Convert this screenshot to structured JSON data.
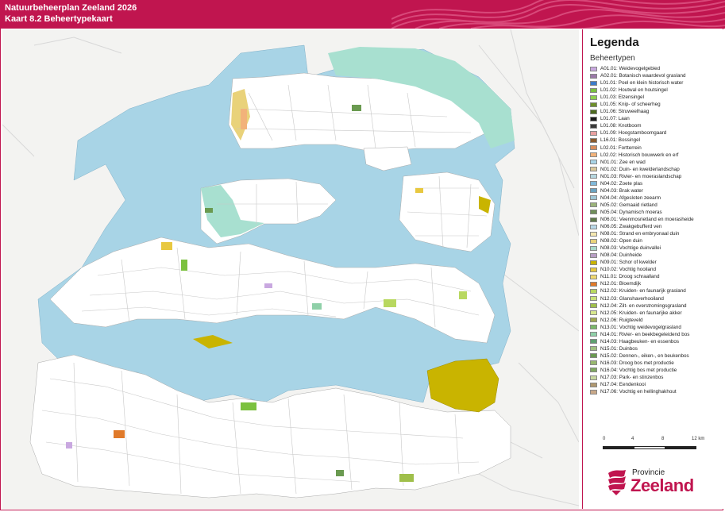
{
  "header": {
    "title": "Natuurbeheerplan Zeeland 2026",
    "subtitle": "Kaart 8.2 Beheertypekaart",
    "color": "#c0154f"
  },
  "legend": {
    "title": "Legenda",
    "subtitle": "Beheertypen",
    "items": [
      {
        "label": "A01.01: Weidevogelgebied",
        "color": "#c9a8e0"
      },
      {
        "label": "A02.01: Botanisch waardevol grasland",
        "color": "#9b7aa8"
      },
      {
        "label": "L01.01: Poel en klein historisch water",
        "color": "#3d7cc9"
      },
      {
        "label": "L01.02: Houtwal en houtsingel",
        "color": "#7bc13f"
      },
      {
        "label": "L01.03: Elzensingel",
        "color": "#8fd14f"
      },
      {
        "label": "L01.05: Knip- of scheerheg",
        "color": "#6e8f2a"
      },
      {
        "label": "L01.06: Struweelhaag",
        "color": "#4d6b1f"
      },
      {
        "label": "L01.07: Laan",
        "color": "#1a1a1a"
      },
      {
        "label": "L01.08: Knotboom",
        "color": "#3a3a3a"
      },
      {
        "label": "L01.09: Hoogstamboomgaard",
        "color": "#e8a0a0"
      },
      {
        "label": "L16.01: Bossingel",
        "color": "#8a5a2c"
      },
      {
        "label": "L02.01: Fortterrein",
        "color": "#d98e5c"
      },
      {
        "label": "L02.02: Historisch bouwwerk en erf",
        "color": "#f2b27a"
      },
      {
        "label": "N01.01: Zee en wad",
        "color": "#a8d4e6"
      },
      {
        "label": "N01.02: Duin- en kwelderlandschap",
        "color": "#d9c89a"
      },
      {
        "label": "N01.03: Rivier- en moeraslandschap",
        "color": "#b6d7e0"
      },
      {
        "label": "N04.02: Zoete plas",
        "color": "#7fb8d9"
      },
      {
        "label": "N04.03: Brak water",
        "color": "#6aa3c0"
      },
      {
        "label": "N04.04: Afgesloten zeearm",
        "color": "#9fc7d6"
      },
      {
        "label": "N05.02: Gemaaid rietland",
        "color": "#9bb37a"
      },
      {
        "label": "N05.04: Dynamisch moeras",
        "color": "#6f8f5a"
      },
      {
        "label": "N06.01: Veenmosrietland en moerasheide",
        "color": "#5f7a4a"
      },
      {
        "label": "N06.05: Zwakgebufferd ven",
        "color": "#b8d8e8"
      },
      {
        "label": "N08.01: Strand en embryonaal duin",
        "color": "#f4e7b0"
      },
      {
        "label": "N08.02: Open duin",
        "color": "#e9d27a"
      },
      {
        "label": "N08.03: Vochtige duinvallei",
        "color": "#a8d8c8"
      },
      {
        "label": "N08.04: Duinheide",
        "color": "#b89ec4"
      },
      {
        "label": "N09.01: Schor of kwelder",
        "color": "#c9b400"
      },
      {
        "label": "N10.02: Vochtig hooiland",
        "color": "#e8c840"
      },
      {
        "label": "N11.01: Droog schraalland",
        "color": "#f0d870"
      },
      {
        "label": "N12.01: Bloemdijk",
        "color": "#e07a2a"
      },
      {
        "label": "N12.02: Kruiden- en faunarijk grasland",
        "color": "#b8d860"
      },
      {
        "label": "N12.03: Glanshaverhooiland",
        "color": "#c8e07a"
      },
      {
        "label": "N12.04: Zilt- en overstromingsgrasland",
        "color": "#9fbf4a"
      },
      {
        "label": "N12.05: Kruiden- en faunarijke akker",
        "color": "#d8e890"
      },
      {
        "label": "N12.06: Ruigteveld",
        "color": "#a0a850"
      },
      {
        "label": "N13.01: Vochtig weidevogelgrasland",
        "color": "#7ab86a"
      },
      {
        "label": "N14.01: Rivier- en beekbegeleidend bos",
        "color": "#8fd0a8"
      },
      {
        "label": "N14.03: Haagbeuken- en essenbos",
        "color": "#5fa070"
      },
      {
        "label": "N15.01: Duinbos",
        "color": "#9fc080"
      },
      {
        "label": "N15.02: Dennen-, eiken-, en beukenbos",
        "color": "#6a9a50"
      },
      {
        "label": "N16.03: Droog bos met productie",
        "color": "#98b870"
      },
      {
        "label": "N16.04: Vochtig bos met productie",
        "color": "#7fa860"
      },
      {
        "label": "N17.03: Park- en stinzenbos",
        "color": "#c8d8a0"
      },
      {
        "label": "N17.04: Eendenkooi",
        "color": "#b09870"
      },
      {
        "label": "N17.06: Vochtig en hellinghakhout",
        "color": "#c8a888"
      }
    ]
  },
  "scale": {
    "ticks": [
      "0",
      "4",
      "8",
      "12 km"
    ]
  },
  "logo": {
    "small": "Provincie",
    "big": "Zeeland"
  },
  "map": {
    "water_color": "#a8d4e6",
    "land_color": "#ffffff",
    "dune_color": "#a8e0d0",
    "schor_color": "#c9b400"
  }
}
